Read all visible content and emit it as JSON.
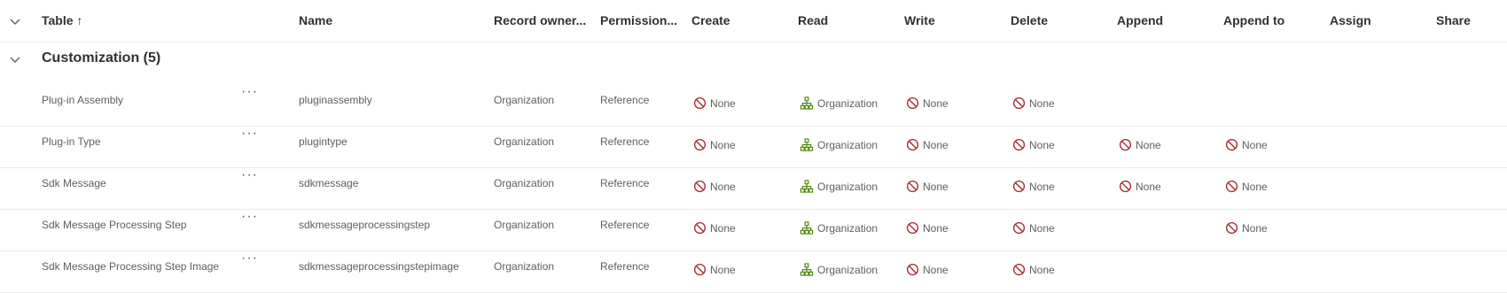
{
  "header": {
    "columns": [
      {
        "key": "table",
        "label": "Table ↑"
      },
      {
        "key": "name",
        "label": "Name"
      },
      {
        "key": "owner",
        "label": "Record owner..."
      },
      {
        "key": "permission",
        "label": "Permission..."
      },
      {
        "key": "create",
        "label": "Create"
      },
      {
        "key": "read",
        "label": "Read"
      },
      {
        "key": "write",
        "label": "Write"
      },
      {
        "key": "delete",
        "label": "Delete"
      },
      {
        "key": "append",
        "label": "Append"
      },
      {
        "key": "append_to",
        "label": "Append to"
      },
      {
        "key": "assign",
        "label": "Assign"
      },
      {
        "key": "share",
        "label": "Share"
      }
    ]
  },
  "group": {
    "title": "Customization (5)"
  },
  "icons": {
    "none_icon": "prohibited-icon",
    "org_icon": "organization-hierarchy-icon",
    "colors": {
      "none": "#a4262c",
      "org": "#498205"
    }
  },
  "rows": [
    {
      "table": "Plug-in Assembly",
      "name": "pluginassembly",
      "owner": "Organization",
      "permission": "Reference",
      "create": "None",
      "read": "Organization",
      "write": "None",
      "delete": "None",
      "append": "",
      "append_to": "",
      "assign": "",
      "share": ""
    },
    {
      "table": "Plug-in Type",
      "name": "plugintype",
      "owner": "Organization",
      "permission": "Reference",
      "create": "None",
      "read": "Organization",
      "write": "None",
      "delete": "None",
      "append": "None",
      "append_to": "None",
      "assign": "",
      "share": ""
    },
    {
      "table": "Sdk Message",
      "name": "sdkmessage",
      "owner": "Organization",
      "permission": "Reference",
      "create": "None",
      "read": "Organization",
      "write": "None",
      "delete": "None",
      "append": "None",
      "append_to": "None",
      "assign": "",
      "share": ""
    },
    {
      "table": "Sdk Message Processing Step",
      "name": "sdkmessageprocessingstep",
      "owner": "Organization",
      "permission": "Reference",
      "create": "None",
      "read": "Organization",
      "write": "None",
      "delete": "None",
      "append": "",
      "append_to": "None",
      "assign": "",
      "share": ""
    },
    {
      "table": "Sdk Message Processing Step Image",
      "name": "sdkmessageprocessingstepimage",
      "owner": "Organization",
      "permission": "Reference",
      "create": "None",
      "read": "Organization",
      "write": "None",
      "delete": "None",
      "append": "",
      "append_to": "",
      "assign": "",
      "share": ""
    }
  ]
}
